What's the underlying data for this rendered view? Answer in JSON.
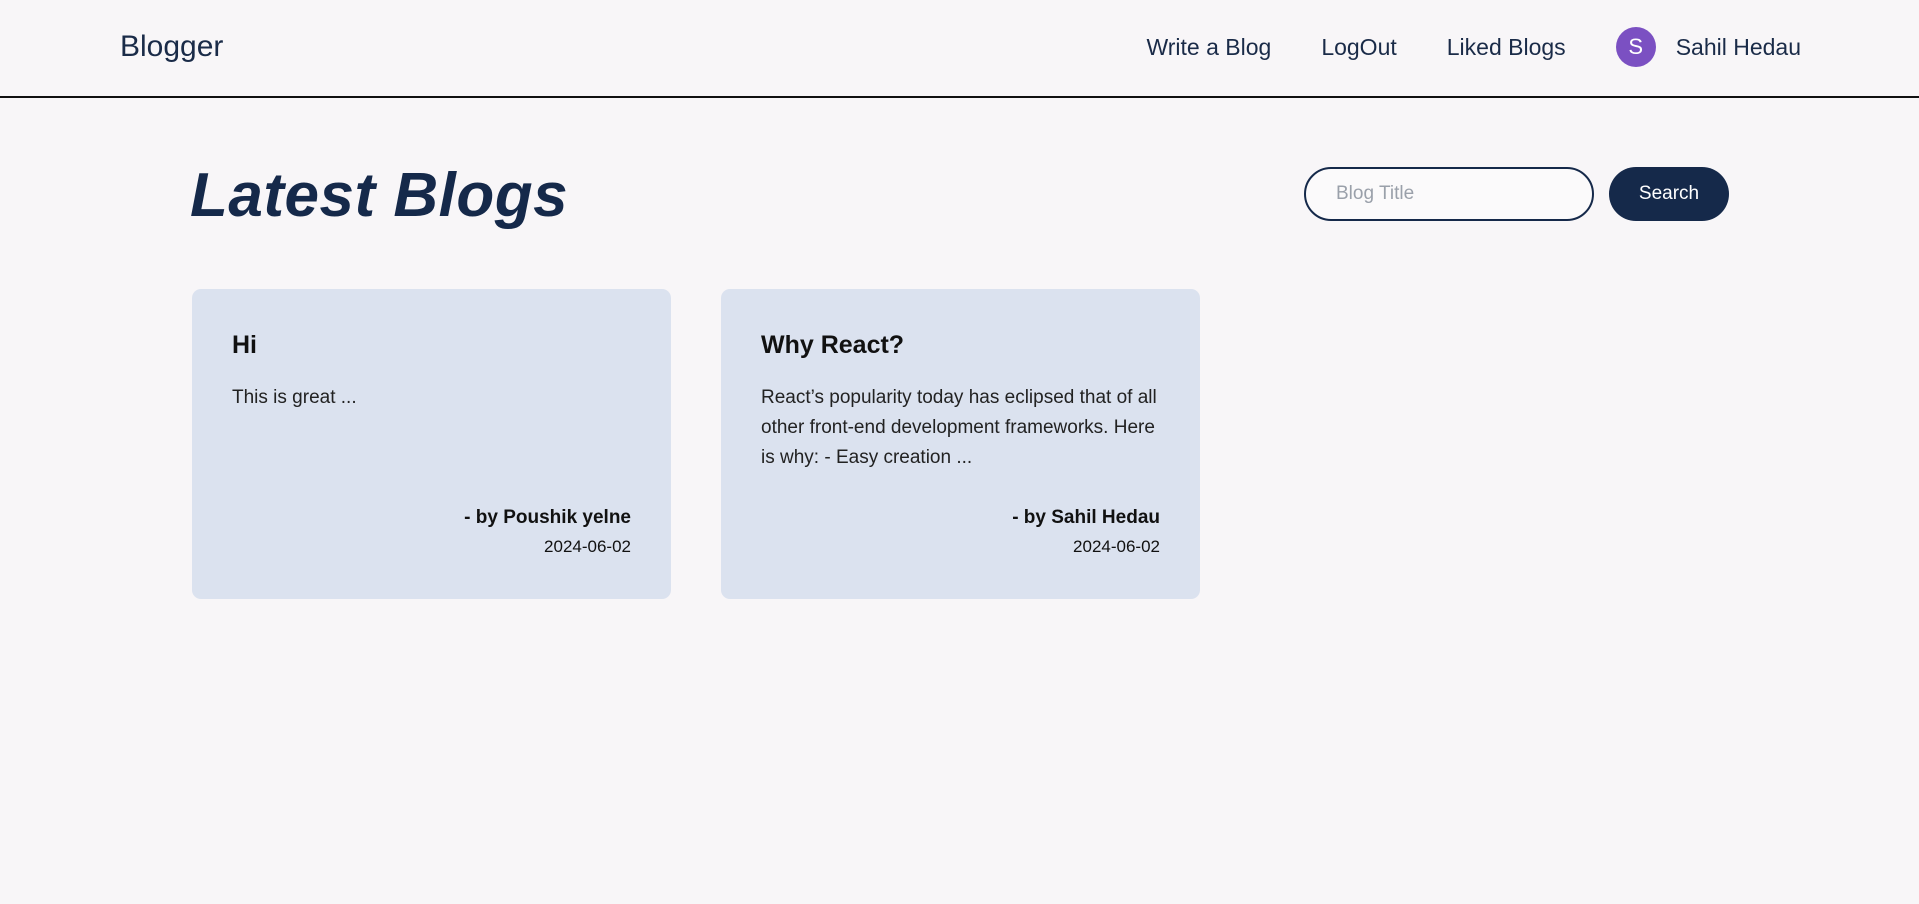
{
  "navbar": {
    "brand": "Blogger",
    "links": [
      "Write a Blog",
      "LogOut",
      "Liked Blogs"
    ],
    "user": {
      "initial": "S",
      "name": "Sahil Hedau"
    }
  },
  "main": {
    "title": "Latest Blogs",
    "search": {
      "placeholder": "Blog Title",
      "value": "",
      "button_label": "Search"
    }
  },
  "blogs": [
    {
      "title": "Hi",
      "excerpt": "This is great ...",
      "author": "- by Poushik yelne",
      "date": "2024-06-02"
    },
    {
      "title": "Why React?",
      "excerpt": "React’s popularity today has eclipsed that of all other front-end development frameworks. Here is why: - Easy creation ...",
      "author": "- by Sahil Hedau",
      "date": "2024-06-02"
    }
  ],
  "colors": {
    "background": "#f8f6f8",
    "primary": "#15294a",
    "card": "#dbe2ef",
    "avatar": "#7b50c2"
  }
}
